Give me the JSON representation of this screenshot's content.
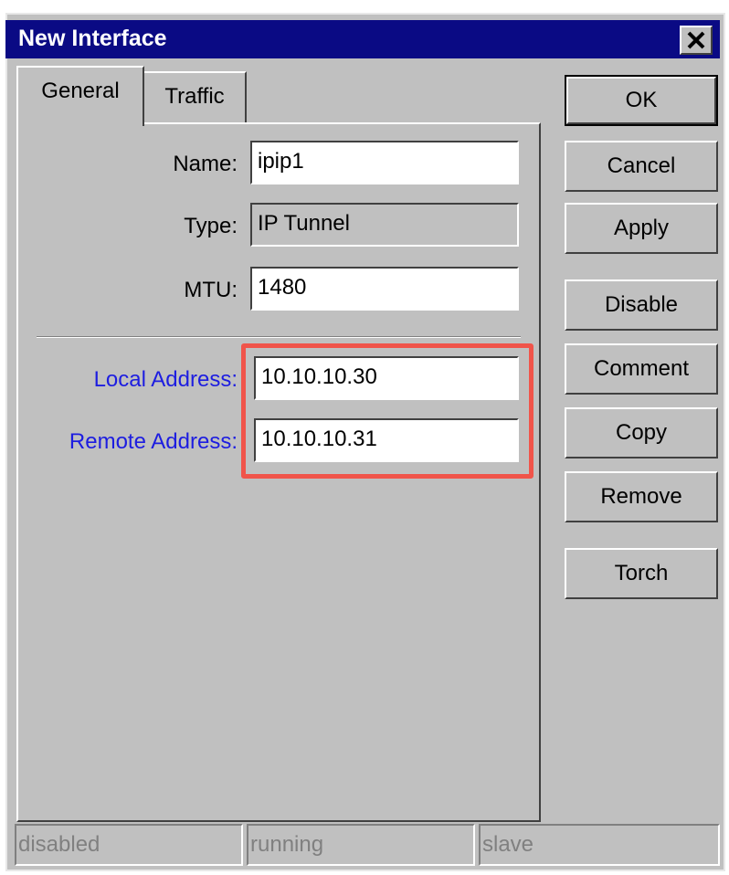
{
  "window": {
    "title": "New Interface",
    "close_icon": "close-icon"
  },
  "tabs": [
    {
      "label": "General",
      "active": true
    },
    {
      "label": "Traffic",
      "active": false
    }
  ],
  "fields": {
    "name": {
      "label": "Name:",
      "value": "ipip1"
    },
    "type": {
      "label": "Type:",
      "value": "IP Tunnel"
    },
    "mtu": {
      "label": "MTU:",
      "value": "1480"
    },
    "local_address": {
      "label": "Local Address:",
      "value": "10.10.10.30"
    },
    "remote_address": {
      "label": "Remote Address:",
      "value": "10.10.10.31"
    }
  },
  "buttons": {
    "ok": "OK",
    "cancel": "Cancel",
    "apply": "Apply",
    "disable": "Disable",
    "comment": "Comment",
    "copy": "Copy",
    "remove": "Remove",
    "torch": "Torch"
  },
  "status": {
    "disabled": "disabled",
    "running": "running",
    "slave": "slave"
  },
  "colors": {
    "titlebar": "#0a0a84",
    "face": "#c0c0c0",
    "label_blue": "#1d1de0",
    "highlight": "#f0544a"
  }
}
